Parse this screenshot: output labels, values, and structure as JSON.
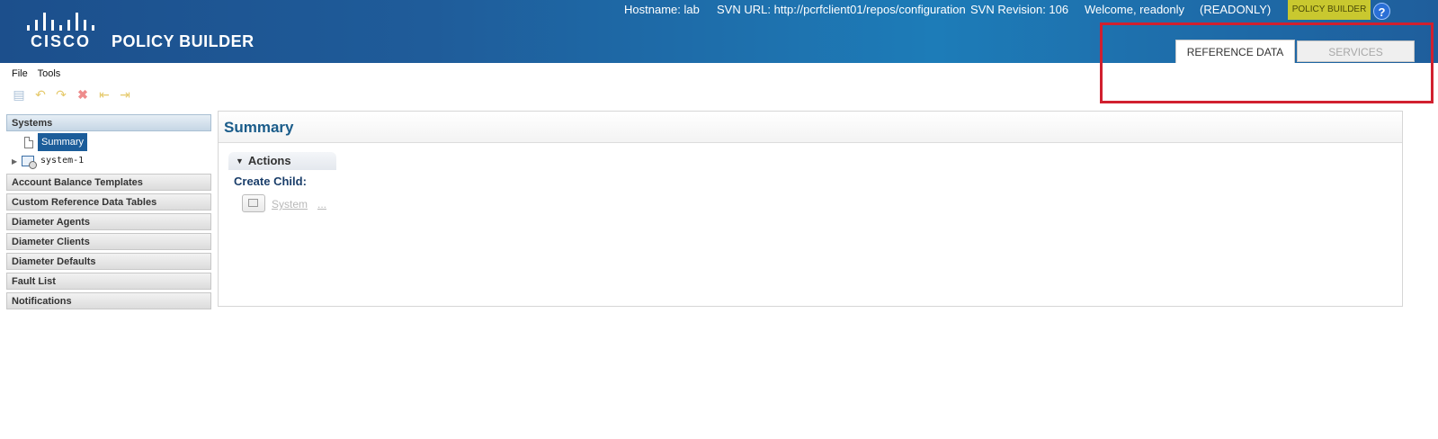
{
  "header": {
    "logo_text": "CISCO",
    "app_title": "POLICY BUILDER",
    "hostname": "Hostname: lab",
    "svn_url": "SVN URL: http://pcrfclient01/repos/configuration",
    "svn_revision": "SVN Revision: 106",
    "welcome": "Welcome, readonly",
    "mode": "(READONLY)",
    "badge": "POLICY BUILDER",
    "help_glyph": "?",
    "tabs": [
      {
        "label": "REFERENCE DATA",
        "active": true
      },
      {
        "label": "SERVICES",
        "active": false
      }
    ],
    "colors": {
      "header_bg": "#1d6fae",
      "badge_bg": "#c9c82f",
      "highlight": "#d1202f"
    }
  },
  "menu": {
    "items": [
      "File",
      "Tools"
    ]
  },
  "toolbar": {
    "icons": [
      "save-icon",
      "undo-icon",
      "redo-icon",
      "delete-icon",
      "move-left-icon",
      "move-right-icon"
    ]
  },
  "left_panel": {
    "systems_header": "Systems",
    "tree": [
      {
        "label": "Summary",
        "selected": true,
        "icon": "document-icon"
      },
      {
        "label": "system-1",
        "selected": false,
        "icon": "system-icon"
      }
    ],
    "sections": [
      "Account Balance Templates",
      "Custom Reference Data Tables",
      "Diameter Agents",
      "Diameter Clients",
      "Diameter Defaults",
      "Fault List",
      "Notifications"
    ]
  },
  "main": {
    "title": "Summary",
    "actions_label": "Actions",
    "create_child_label": "Create Child:",
    "child_link": "System",
    "more_link": "..."
  }
}
